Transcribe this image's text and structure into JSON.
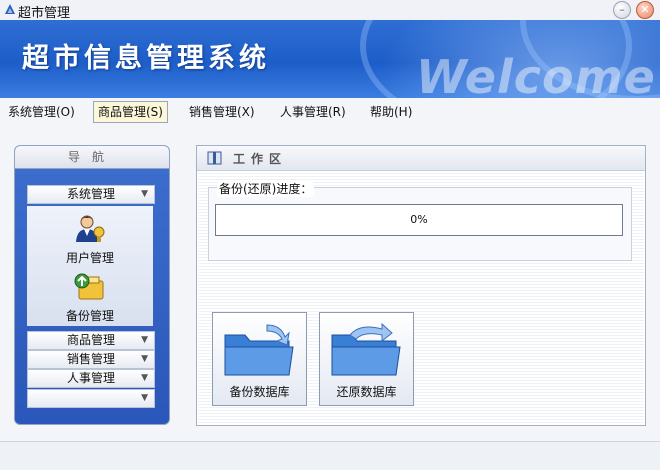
{
  "window": {
    "title": "超市管理",
    "minimize_glyph": "–",
    "close_glyph": "✕"
  },
  "banner": {
    "heading": "超市信息管理系统",
    "welcome": "Welcome"
  },
  "menu": {
    "items": [
      {
        "label": "系统管理(O)"
      },
      {
        "label": "商品管理(S)"
      },
      {
        "label": "销售管理(X)"
      },
      {
        "label": "人事管理(R)"
      },
      {
        "label": "帮助(H)"
      }
    ],
    "active_index": 1
  },
  "nav": {
    "header": "导航",
    "groups": [
      {
        "label": "系统管理"
      },
      {
        "label": "商品管理"
      },
      {
        "label": "销售管理"
      },
      {
        "label": "人事管理"
      },
      {
        "label": ""
      }
    ],
    "tools": [
      {
        "label": "用户管理",
        "icon": "user-manage-icon"
      },
      {
        "label": "备份管理",
        "icon": "backup-manage-icon"
      }
    ]
  },
  "work": {
    "title": "工作区",
    "progress_label": "备份(还原)进度：",
    "progress_text": "0%",
    "progress_value": 0,
    "buttons": [
      {
        "label": "备份数据库",
        "icon": "backup-folder-icon"
      },
      {
        "label": "还原数据库",
        "icon": "restore-folder-icon"
      }
    ]
  },
  "colors": {
    "banner_blue": "#1d5dc9",
    "nav_blue": "#2a57b9",
    "folder_blue": "#3a7fd6"
  }
}
